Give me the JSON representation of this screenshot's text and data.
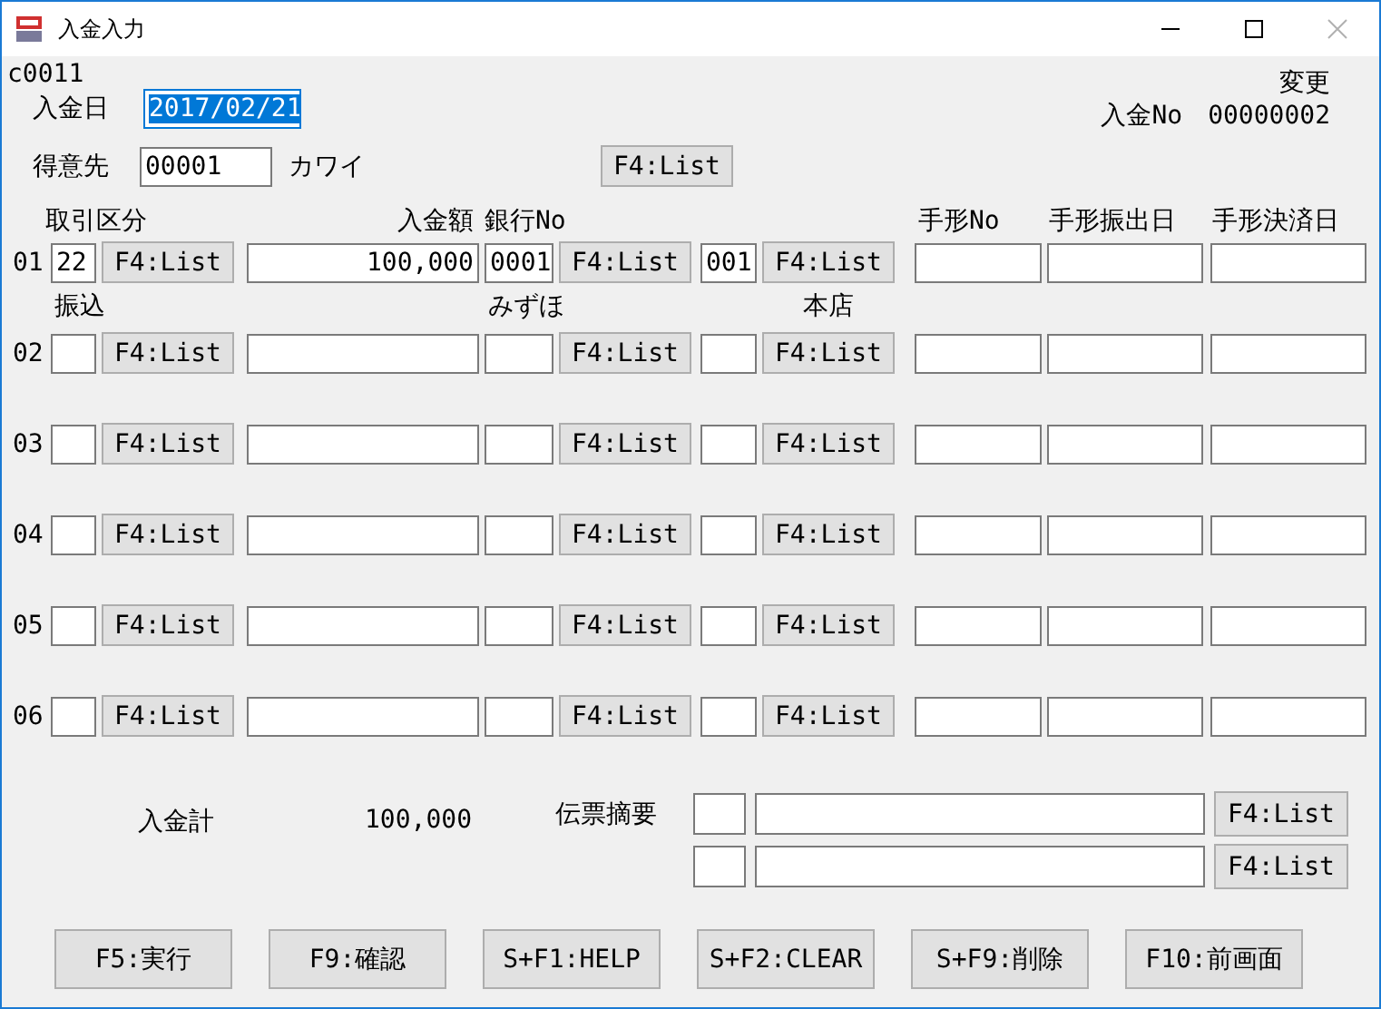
{
  "window": {
    "title": "入金入力"
  },
  "screen_code": "c0011",
  "mode": "変更",
  "slip_no_label": "入金No",
  "slip_no": "00000002",
  "date": {
    "label": "入金日",
    "value": "2017/02/21",
    "text_selected": true
  },
  "customer": {
    "label": "得意先",
    "code": "00001",
    "name": "カワイ",
    "button": "F4:List"
  },
  "columns": {
    "type": "取引区分",
    "amount": "入金額",
    "bank": "銀行No",
    "bill_no": "手形No",
    "bill_issue_date": "手形振出日",
    "bill_settle_date": "手形決済日"
  },
  "rows": [
    {
      "no": "01",
      "type_code": "22",
      "type_name": "振込",
      "amount": "100,000",
      "bank_no": "0001",
      "bank_name": "みずほ",
      "branch_no": "001",
      "branch_name": "本店",
      "buttons": [
        "F4:List",
        "F4:List",
        "F4:List"
      ]
    },
    {
      "no": "02",
      "buttons": [
        "F4:List",
        "F4:List",
        "F4:List"
      ]
    },
    {
      "no": "03",
      "buttons": [
        "F4:List",
        "F4:List",
        "F4:List"
      ]
    },
    {
      "no": "04",
      "buttons": [
        "F4:List",
        "F4:List",
        "F4:List"
      ]
    },
    {
      "no": "05",
      "buttons": [
        "F4:List",
        "F4:List",
        "F4:List"
      ]
    },
    {
      "no": "06",
      "buttons": [
        "F4:List",
        "F4:List",
        "F4:List"
      ]
    }
  ],
  "total": {
    "label": "入金計",
    "value": "100,000"
  },
  "memo": {
    "label": "伝票摘要",
    "lines": [
      {
        "button": "F4:List"
      },
      {
        "button": "F4:List"
      }
    ]
  },
  "function_keys": [
    "F5:実行",
    "F9:確認",
    "S+F1:HELP",
    "S+F2:CLEAR",
    "S+F9:削除",
    "F10:前画面"
  ]
}
